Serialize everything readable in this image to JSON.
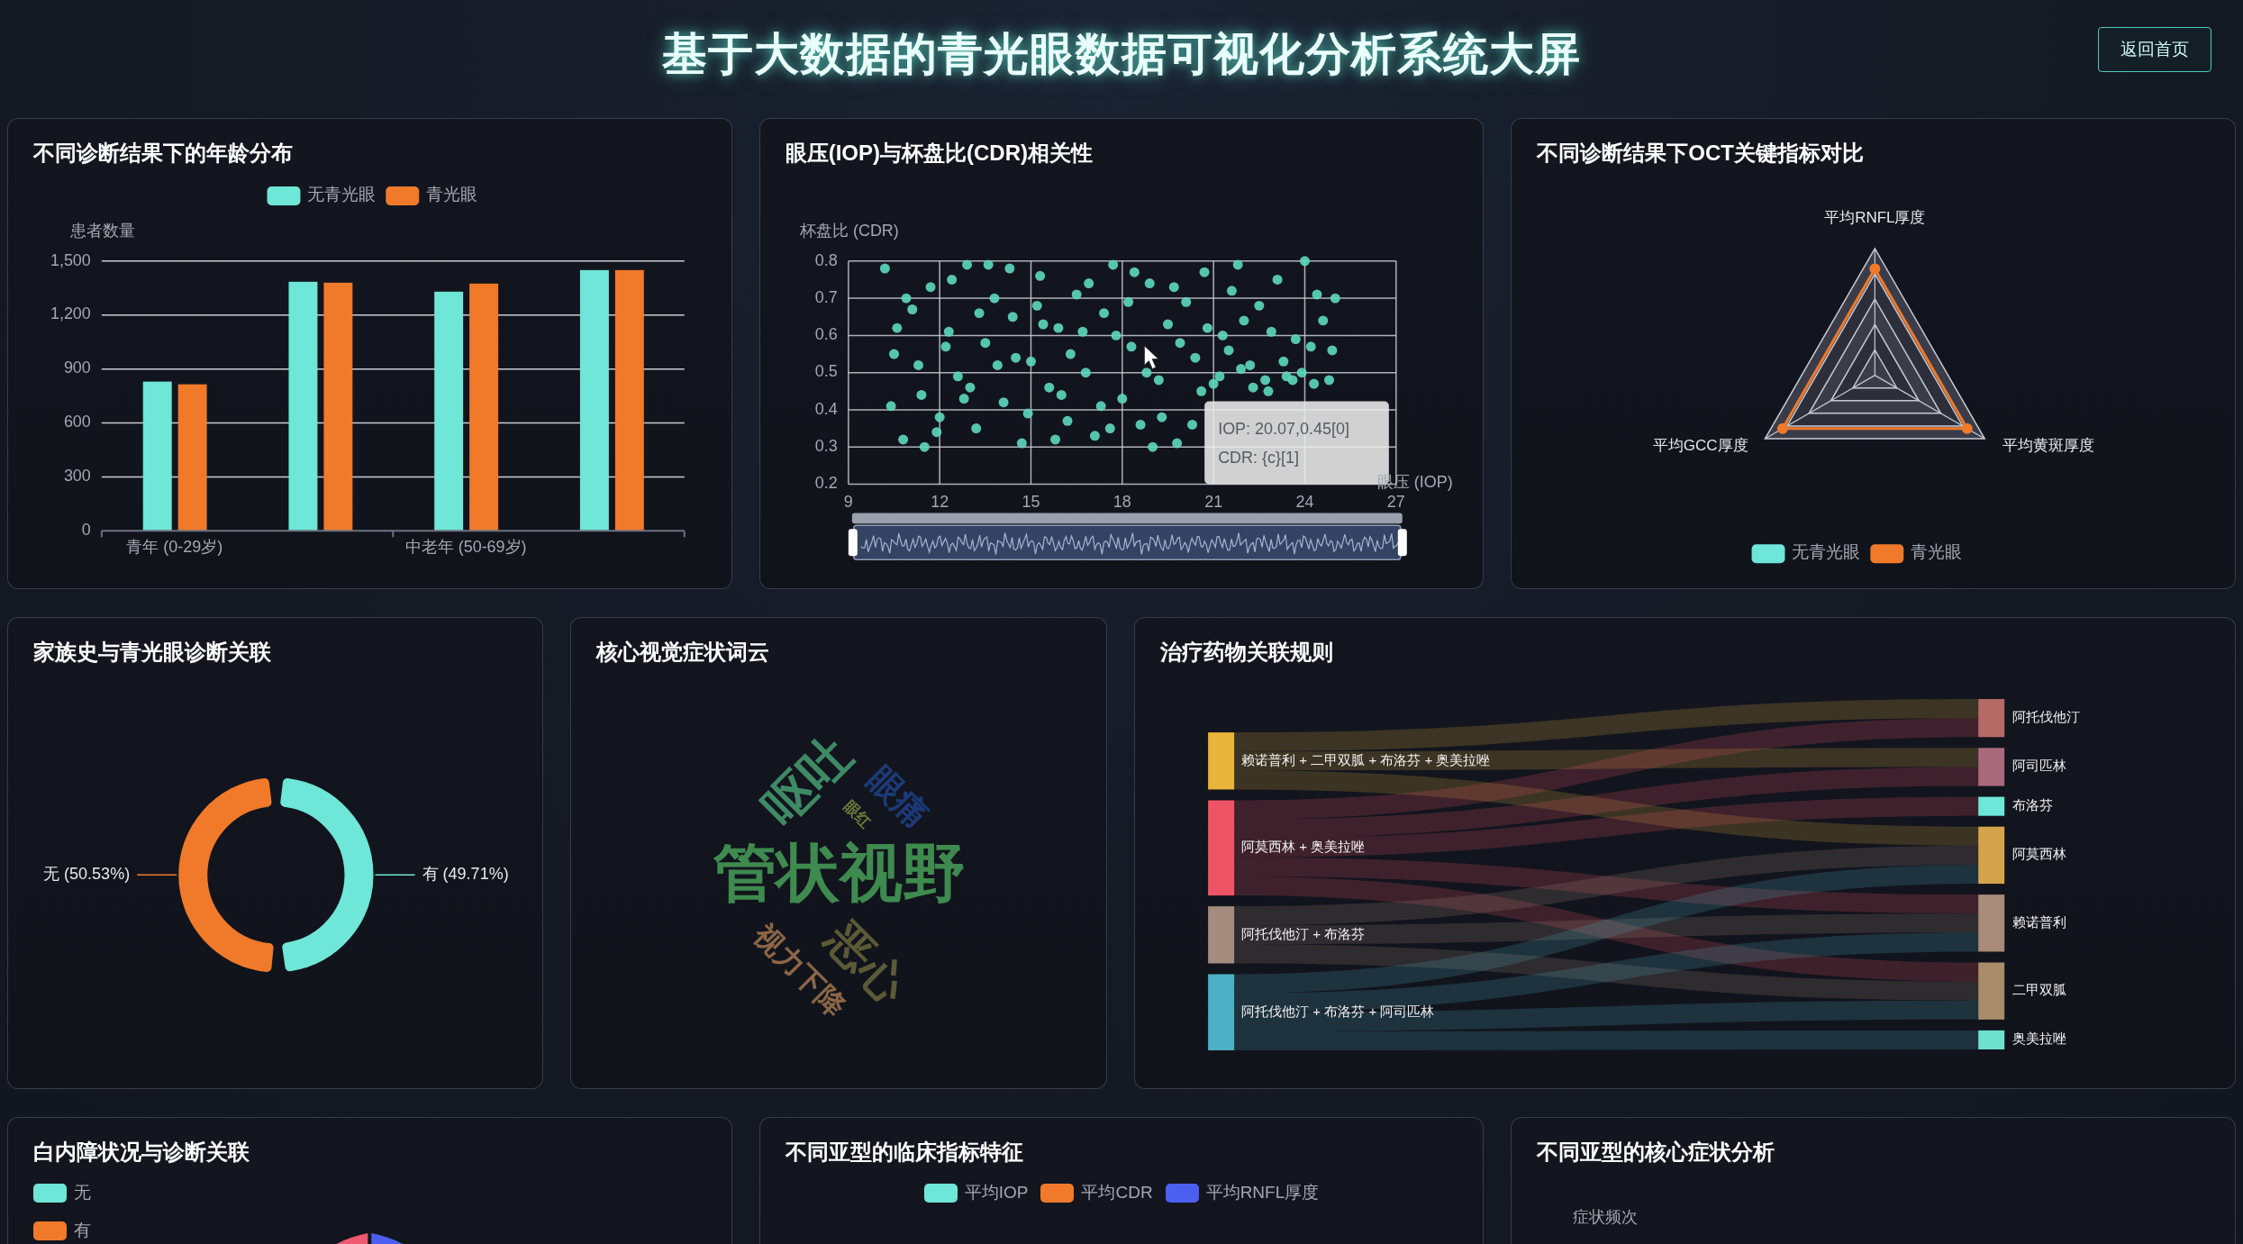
{
  "header": {
    "title": "基于大数据的青光眼数据可视化分析系统大屏",
    "back_button": "返回首页"
  },
  "age_chart": {
    "title": "不同诊断结果下的年龄分布",
    "chart_data": {
      "type": "bar",
      "legend": "top",
      "grid": true,
      "ylabel": "患者数量",
      "categories": [
        "青年 (0-29岁)",
        null,
        "中老年 (50-69岁)",
        null
      ],
      "ylim": [
        0,
        1500
      ],
      "yticks": [
        {
          "value": 0,
          "label": "0"
        },
        {
          "value": 300,
          "label": "300"
        },
        {
          "value": 600,
          "label": "600"
        },
        {
          "value": 900,
          "label": "900"
        },
        {
          "value": 1200,
          "label": "1,200"
        },
        {
          "value": 1500,
          "label": "1,500"
        }
      ],
      "series": [
        {
          "name": "无青光眼",
          "color": "#6ee6d8",
          "values": [
            830,
            1385,
            1330,
            1450
          ]
        },
        {
          "name": "青光眼",
          "color": "#f07a2a",
          "values": [
            815,
            1380,
            1375,
            1450
          ]
        }
      ]
    }
  },
  "iop_cdr_chart": {
    "title": "眼压(IOP)与杯盘比(CDR)相关性",
    "chart_data": {
      "type": "scatter",
      "grid": true,
      "xlabel": "眼压 (IOP)",
      "ylabel": "杯盘比 (CDR)",
      "xlim": [
        9,
        27
      ],
      "ylim": [
        0.2,
        0.8
      ],
      "xticks": [
        9,
        12,
        15,
        18,
        21,
        24,
        27
      ],
      "yticks": [
        0.2,
        0.3,
        0.4,
        0.5,
        0.6,
        0.7,
        0.8
      ],
      "x": [
        10.2,
        10.5,
        10.8,
        11.1,
        11.4,
        11.7,
        12.0,
        12.3,
        12.6,
        12.9,
        13.2,
        13.5,
        13.8,
        14.1,
        14.4,
        14.7,
        15.0,
        15.3,
        15.6,
        15.9,
        16.2,
        16.5,
        16.8,
        17.1,
        17.4,
        17.7,
        18.0,
        18.3,
        18.6,
        18.9,
        19.2,
        19.5,
        19.8,
        20.1,
        20.4,
        20.7,
        21.0,
        21.3,
        21.6,
        21.9,
        22.2,
        22.5,
        22.8,
        23.1,
        23.4,
        23.7,
        24.0,
        24.3,
        24.6,
        24.9,
        10.4,
        10.9,
        11.3,
        11.9,
        12.4,
        12.8,
        13.3,
        13.9,
        14.3,
        14.9,
        15.4,
        15.8,
        16.3,
        16.9,
        17.3,
        17.8,
        18.4,
        18.8,
        19.3,
        19.9,
        20.3,
        20.8,
        21.2,
        21.8,
        22.3,
        22.9,
        23.3,
        23.9,
        24.4,
        24.8,
        10.6,
        11.5,
        12.2,
        13.0,
        13.6,
        14.5,
        15.2,
        16.0,
        16.7,
        17.6,
        18.2,
        19.0,
        19.7,
        20.6,
        21.5,
        22.0,
        22.7,
        23.6,
        24.2,
        25.0
      ],
      "series": [
        {
          "color": "#5ed8c0",
          "values": [
            0.78,
            0.55,
            0.32,
            0.67,
            0.44,
            0.73,
            0.38,
            0.61,
            0.49,
            0.79,
            0.35,
            0.58,
            0.7,
            0.42,
            0.65,
            0.31,
            0.53,
            0.76,
            0.46,
            0.62,
            0.37,
            0.71,
            0.5,
            0.33,
            0.66,
            0.79,
            0.43,
            0.57,
            0.36,
            0.74,
            0.48,
            0.63,
            0.31,
            0.69,
            0.54,
            0.77,
            0.47,
            0.6,
            0.72,
            0.51,
            0.52,
            0.68,
            0.45,
            0.75,
            0.49,
            0.59,
            0.8,
            0.47,
            0.64,
            0.56,
            0.41,
            0.7,
            0.52,
            0.34,
            0.75,
            0.43,
            0.66,
            0.52,
            0.78,
            0.39,
            0.63,
            0.32,
            0.55,
            0.74,
            0.41,
            0.6,
            0.77,
            0.5,
            0.38,
            0.58,
            0.36,
            0.62,
            0.49,
            0.79,
            0.46,
            0.61,
            0.53,
            0.5,
            0.71,
            0.48,
            0.62,
            0.3,
            0.57,
            0.46,
            0.79,
            0.54,
            0.68,
            0.44,
            0.61,
            0.35,
            0.69,
            0.3,
            0.73,
            0.45,
            0.56,
            0.64,
            0.48,
            0.48,
            0.57,
            0.7
          ]
        }
      ]
    },
    "tooltip": [
      "IOP: 20.07,0.45[0]",
      "CDR: {c}[1]"
    ]
  },
  "oct_chart": {
    "title": "不同诊断结果下OCT关键指标对比",
    "axes": [
      "平均RNFL厚度",
      "平均GCC厚度",
      "平均黄斑厚度"
    ],
    "legend": [
      {
        "label": "无青光眼",
        "color": "#6ee6d8"
      },
      {
        "label": "青光眼",
        "color": "#f07a2a"
      }
    ]
  },
  "family_history_chart": {
    "title": "家族史与青光眼诊断关联",
    "slices": [
      {
        "color": "#f07a2a"
      },
      {
        "color": "#6ee6d8"
      }
    ],
    "chart_data": {
      "type": "donut",
      "values": [
        50.53,
        49.71
      ],
      "value_labels": [
        "无 (50.53%)",
        "有 (49.71%)"
      ]
    }
  },
  "symptom_cloud": {
    "title": "核心视觉症状词云",
    "words": [
      {
        "text": "呕吐",
        "color": "#3e8a65"
      },
      {
        "text": "眼痛",
        "color": "#1c3a78"
      },
      {
        "text": "眼红",
        "color": "#6b7a3a"
      },
      {
        "text": "管状视野",
        "color": "#3f8a4f"
      },
      {
        "text": "恶心",
        "color": "#5c5a36"
      },
      {
        "text": "视力下降",
        "color": "#8b6647"
      }
    ]
  },
  "drug_rules": {
    "title": "治疗药物关联规则",
    "sources": [
      {
        "label": "赖诺普利 + 二甲双胍 + 布洛芬 + 奥美拉唑",
        "color": "#e8b43a"
      },
      {
        "label": "阿莫西林 + 奥美拉唑",
        "color": "#ef5466"
      },
      {
        "label": "阿托伐他汀 + 布洛芬",
        "color": "#a38b7e"
      },
      {
        "label": "阿托伐他汀 + 布洛芬 + 阿司匹林",
        "color": "#4eb0c4"
      }
    ],
    "targets": [
      {
        "label": "阿托伐他汀",
        "color": "#b56a66"
      },
      {
        "label": "阿司匹林",
        "color": "#a86a7c"
      },
      {
        "label": "布洛芬",
        "color": "#6ee6d8"
      },
      {
        "label": "阿莫西林",
        "color": "#d4a44c"
      },
      {
        "label": "赖诺普利",
        "color": "#a88b78"
      },
      {
        "label": "二甲双胍",
        "color": "#a88c6c"
      },
      {
        "label": "奥美拉唑",
        "color": "#6ee0cc"
      }
    ]
  },
  "cataract_chart": {
    "title": "白内障状况与诊断关联",
    "legend": [
      {
        "label": "无",
        "color": "#6ee6d8"
      },
      {
        "label": "有",
        "color": "#f07a2a"
      }
    ]
  },
  "subtype_indicators": {
    "title": "不同亚型的临床指标特征",
    "legend": [
      {
        "label": "平均IOP",
        "color": "#6ee6d8"
      },
      {
        "label": "平均CDR",
        "color": "#f07a2a"
      },
      {
        "label": "平均RNFL厚度",
        "color": "#4d5ff0"
      }
    ]
  },
  "subtype_symptoms": {
    "title": "不同亚型的核心症状分析",
    "ylabel": "症状频次"
  }
}
